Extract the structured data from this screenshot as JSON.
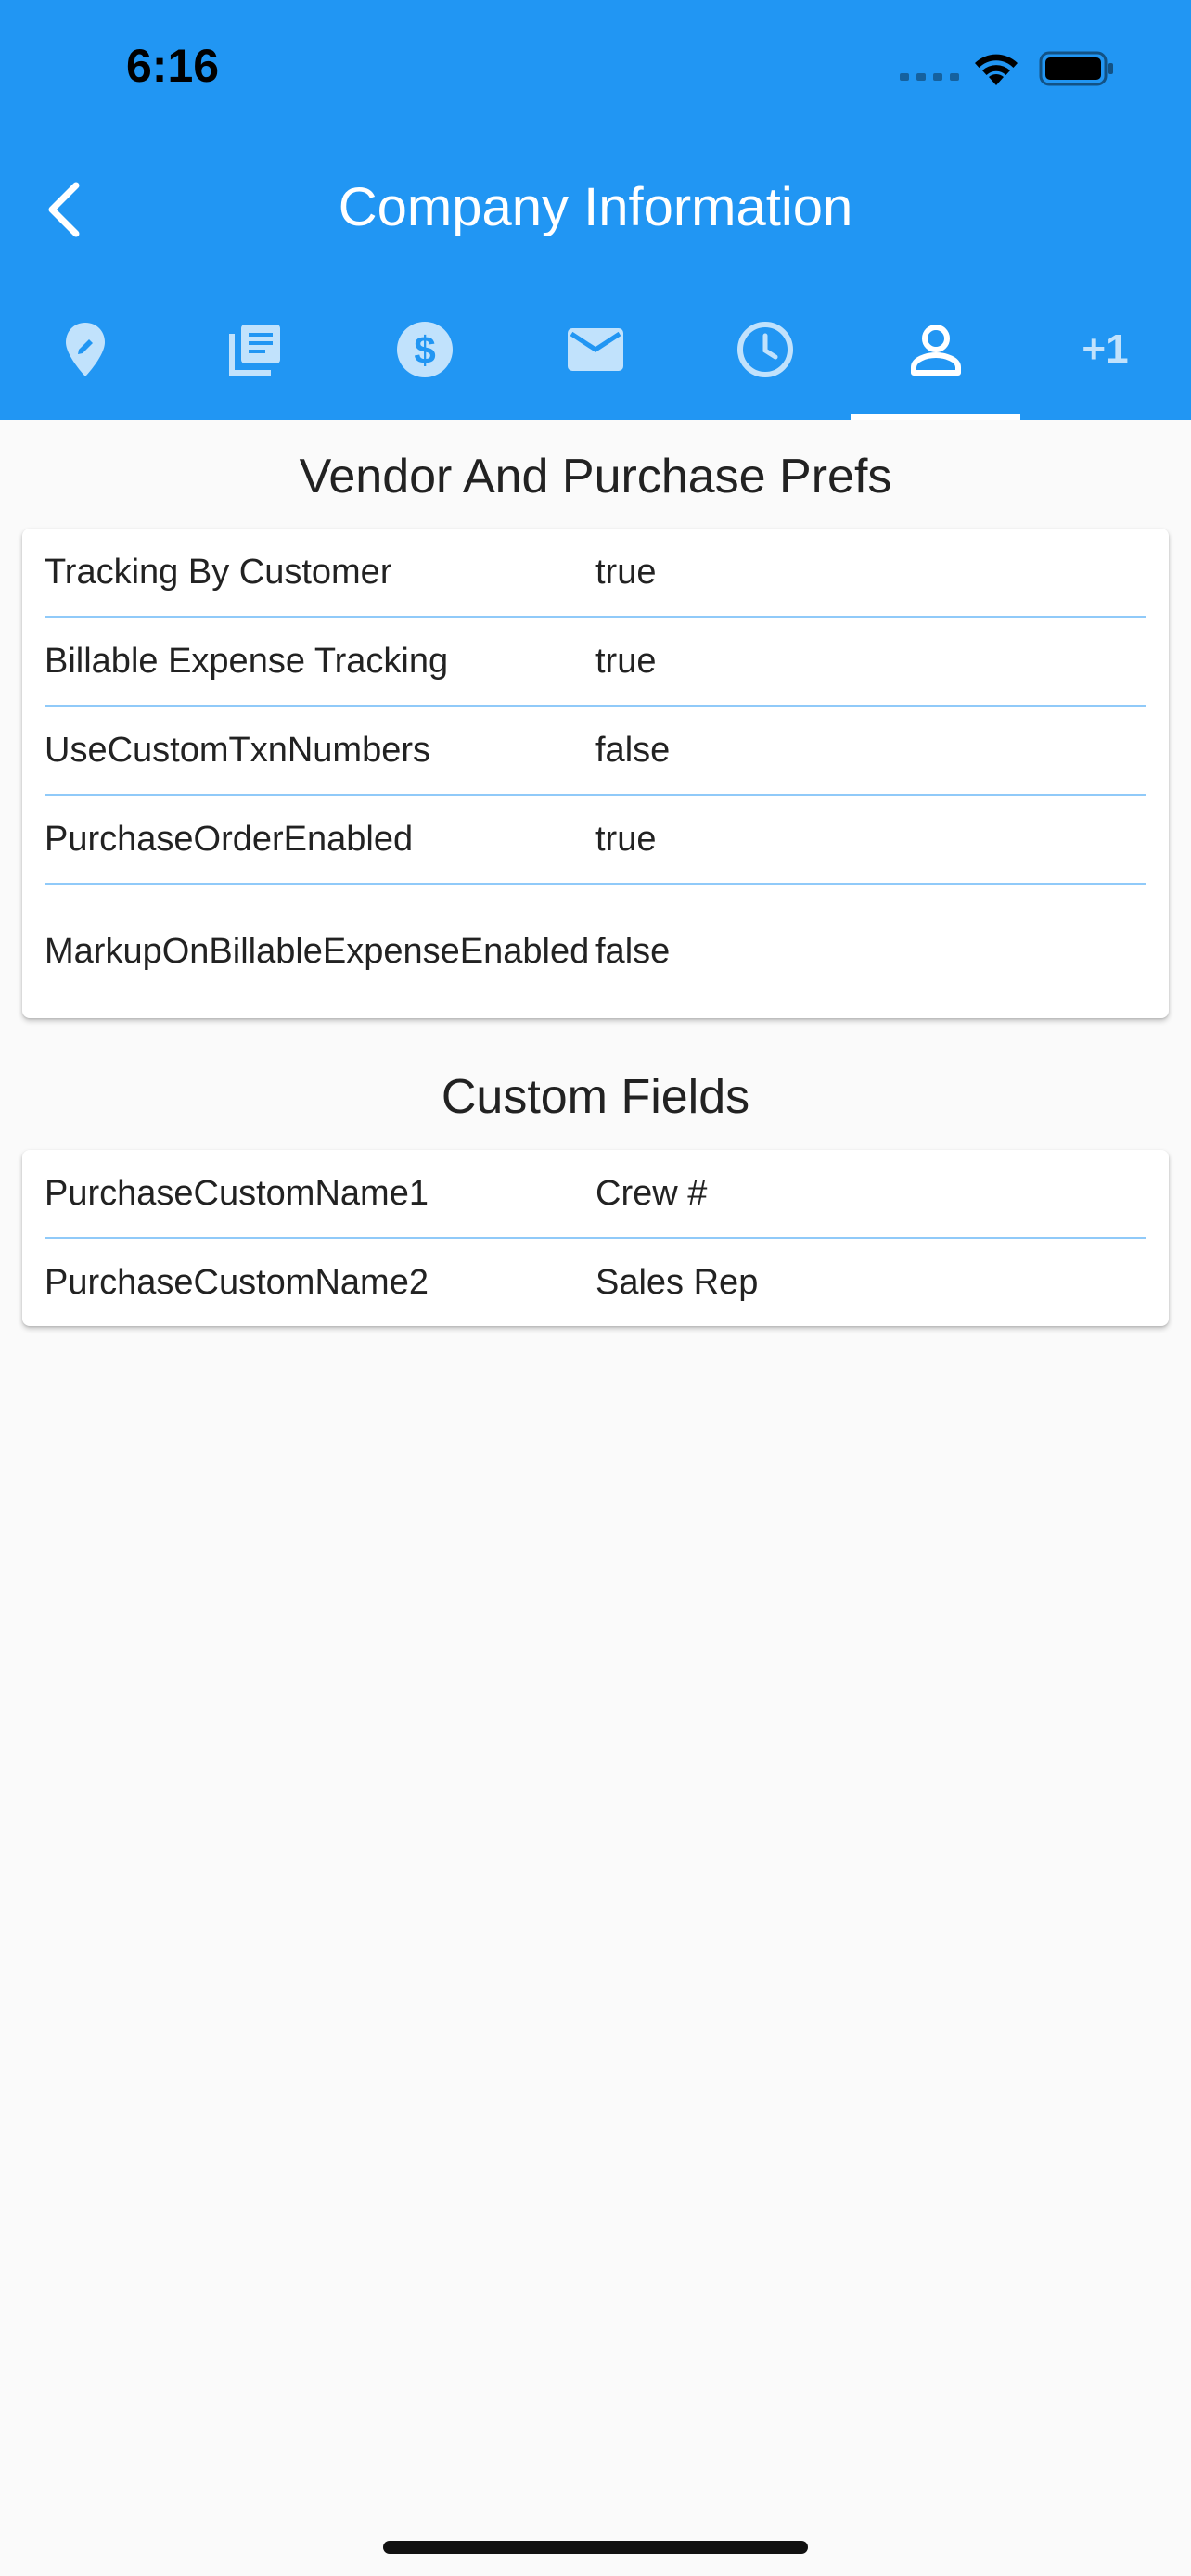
{
  "status_bar": {
    "time": "6:16"
  },
  "appbar": {
    "title": "Company Information"
  },
  "tabs": {
    "items": [
      {
        "icon": "location-pin-icon"
      },
      {
        "icon": "document-list-icon"
      },
      {
        "icon": "dollar-icon"
      },
      {
        "icon": "mail-icon"
      },
      {
        "icon": "clock-icon"
      },
      {
        "icon": "person-icon",
        "selected": true
      },
      {
        "label": "+1"
      }
    ]
  },
  "vendor_section": {
    "title": "Vendor And Purchase Prefs",
    "rows": [
      {
        "label": "Tracking By Customer",
        "value": "true"
      },
      {
        "label": "Billable Expense Tracking",
        "value": "true"
      },
      {
        "label": "UseCustomTxnNumbers",
        "value": "false"
      },
      {
        "label": "PurchaseOrderEnabled",
        "value": "true"
      },
      {
        "label": "MarkupOnBillableExpenseEnabled",
        "value": "false"
      }
    ]
  },
  "custom_section": {
    "title": "Custom Fields",
    "rows": [
      {
        "label": "PurchaseCustomName1",
        "value": "Crew #"
      },
      {
        "label": "PurchaseCustomName2",
        "value": "Sales Rep"
      }
    ]
  },
  "colors": {
    "header": "#2196f3",
    "divider": "#90caf9",
    "background": "#fafafa"
  }
}
